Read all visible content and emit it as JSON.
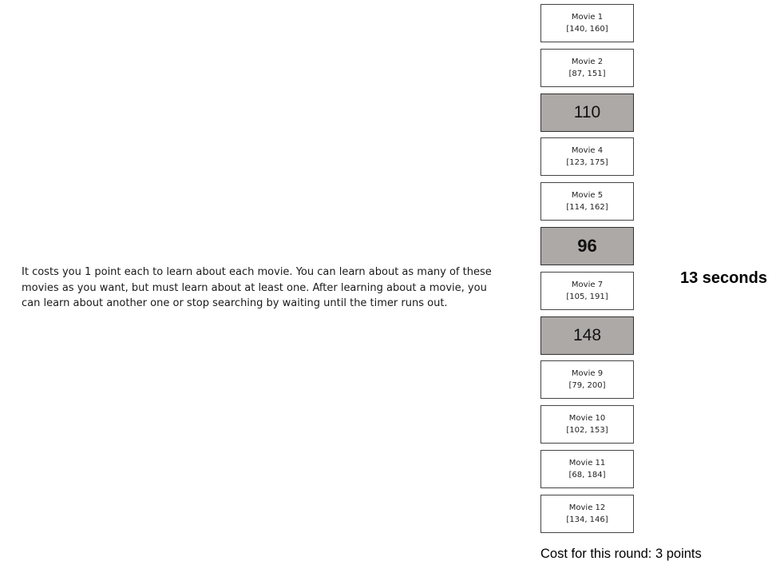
{
  "instructions": "It costs you 1 point each to learn about each movie. You can learn about as many of these movies as you want, but must learn about at least one. After learning about a movie, you can learn about another one or stop searching by waiting until the timer runs out.",
  "movies": [
    {
      "name": "Movie 1",
      "range": "[140, 160]"
    },
    {
      "name": "Movie 2",
      "range": "[87, 151]"
    },
    {
      "value": "110"
    },
    {
      "name": "Movie 4",
      "range": "[123, 175]"
    },
    {
      "name": "Movie 5",
      "range": "[114, 162]"
    },
    {
      "value": "96"
    },
    {
      "name": "Movie 7",
      "range": "[105, 191]"
    },
    {
      "value": "148"
    },
    {
      "name": "Movie 9",
      "range": "[79, 200]"
    },
    {
      "name": "Movie 10",
      "range": "[102, 153]"
    },
    {
      "name": "Movie 11",
      "range": "[68, 184]"
    },
    {
      "name": "Movie 12",
      "range": "[134, 146]"
    }
  ],
  "timer": "13 seconds",
  "cost": "Cost for this round: 3 points",
  "colors": {
    "revealed_background": "#ada9a7",
    "card_border": "#444444"
  }
}
